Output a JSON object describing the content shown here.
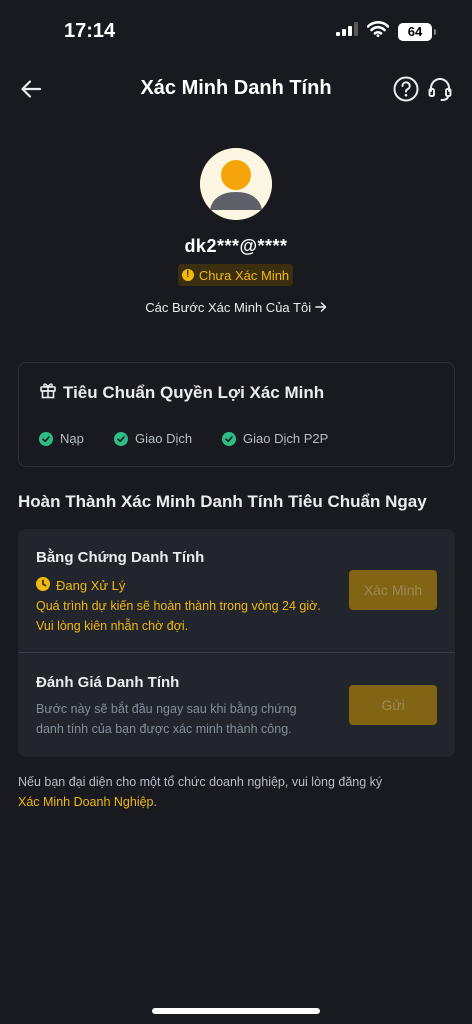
{
  "status_bar": {
    "time": "17:14",
    "battery": "64"
  },
  "nav": {
    "title": "Xác Minh Danh Tính",
    "back_icon": "arrow-left-icon",
    "help_icon": "question-circle-icon",
    "support_icon": "headset-icon"
  },
  "profile": {
    "username": "dk2***@****",
    "status": "Chưa Xác Minh",
    "steps_link": "Các Bước Xác Minh Của Tôi"
  },
  "benefits": {
    "title": "Tiêu Chuẩn Quyền Lợi Xác Minh",
    "items": [
      "Nạp",
      "Giao Dịch",
      "Giao Dịch P2P"
    ]
  },
  "section_title": "Hoàn Thành Xác Minh Danh Tính Tiêu Chuẩn Ngay",
  "verification": {
    "identity_proof": {
      "title": "Bằng Chứng Danh Tính",
      "status": "Đang Xử Lý",
      "description": "Quá trình dự kiến sẽ hoàn thành trong vòng 24 giờ. Vui lòng kiên nhẫn chờ đợi.",
      "button": "Xác Minh"
    },
    "identity_review": {
      "title": "Đánh Giá Danh Tính",
      "description": "Bước này sẽ bắt đầu ngay sau khi bằng chứng danh tính của bạn được xác minh thành công.",
      "button": "Gửi"
    }
  },
  "footer": {
    "text": "Nếu bạn đại diện cho một tổ chức doanh nghiệp, vui lòng đăng ký",
    "link": "Xác Minh Doanh Nghiệp",
    "suffix": "."
  },
  "colors": {
    "background": "#181a20",
    "accent": "#f0b90b",
    "success": "#2ebd85",
    "card": "#22252b"
  }
}
